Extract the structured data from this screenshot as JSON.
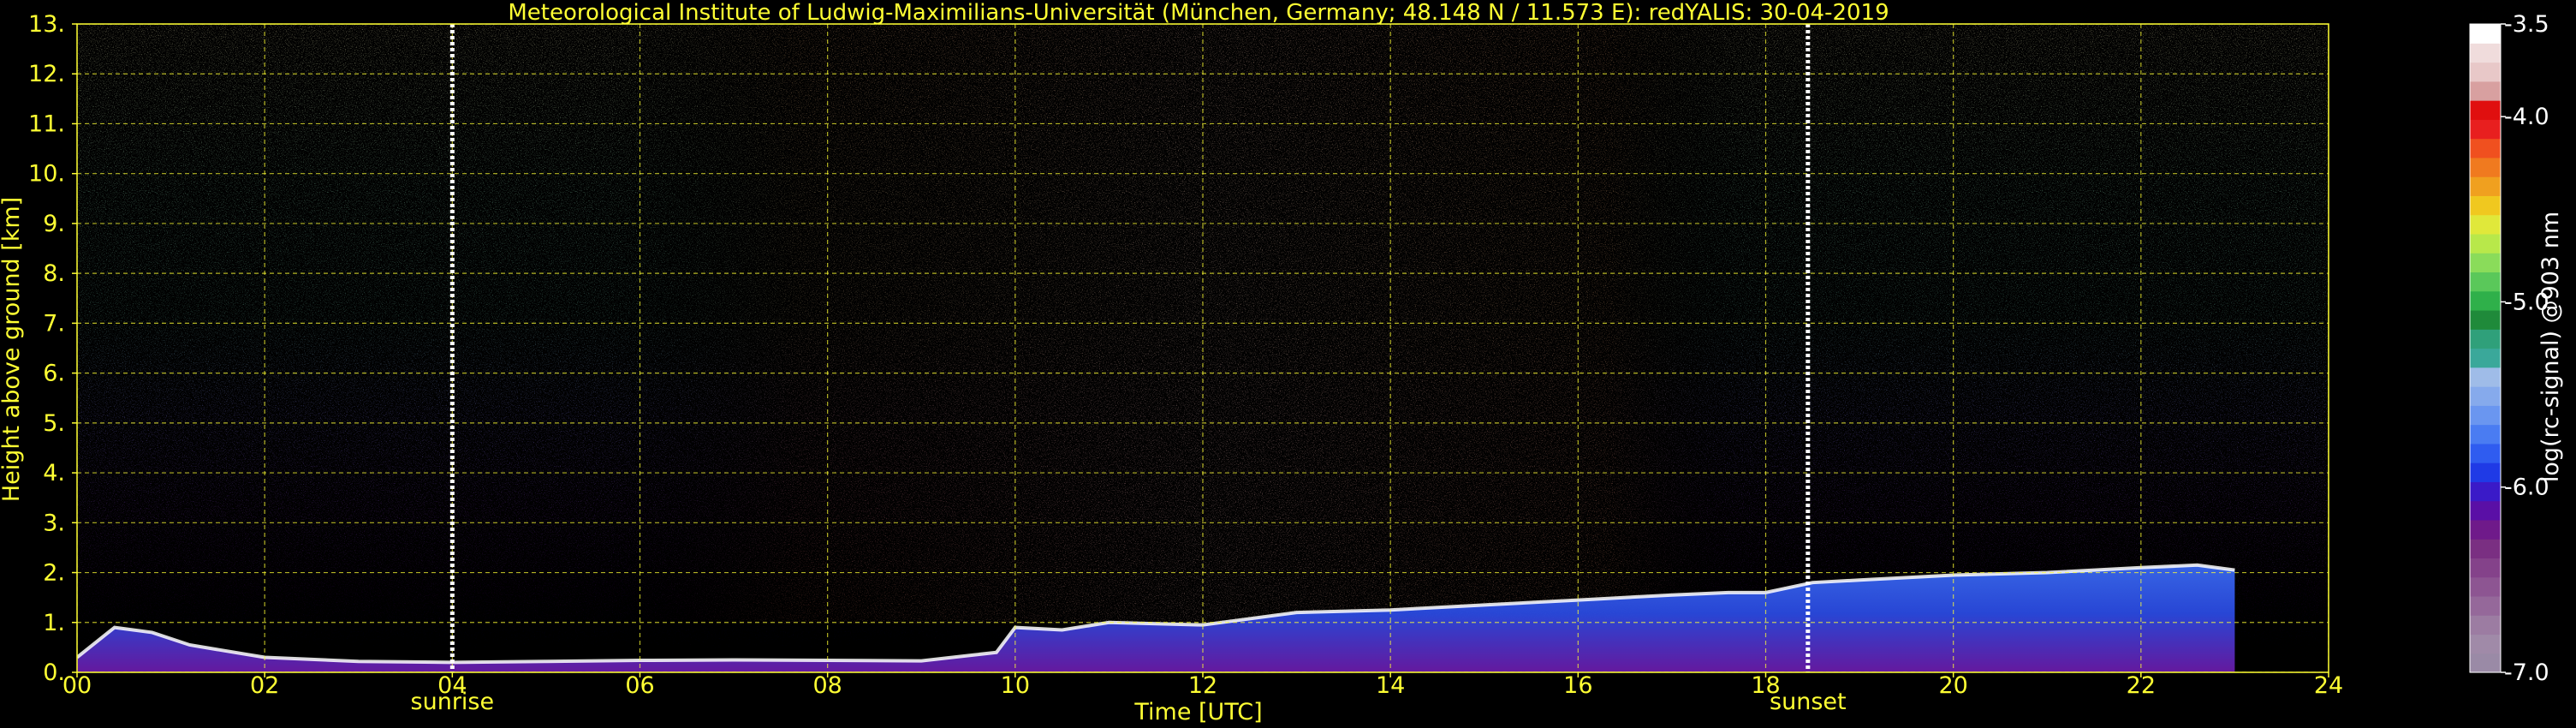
{
  "chart_data": {
    "type": "heatmap",
    "title": "Meteorological Institute of Ludwig-Maximilians-Universität (München, Germany; 48.148 N / 11.573 E):    redYALIS: 30-04-2019",
    "xlabel": "Time [UTC]",
    "ylabel": "Height above ground [km]",
    "colorbar_label": "log(rc-signal) @903 nm",
    "xlim": [
      0,
      24
    ],
    "ylim": [
      0,
      13
    ],
    "x_ticks": [
      0,
      2,
      4,
      6,
      8,
      10,
      12,
      14,
      16,
      18,
      20,
      22,
      24
    ],
    "x_tick_labels": [
      "00",
      "02",
      "04",
      "06",
      "08",
      "10",
      "12",
      "14",
      "16",
      "18",
      "20",
      "22",
      "24"
    ],
    "y_ticks": [
      0,
      1,
      2,
      3,
      4,
      5,
      6,
      7,
      8,
      9,
      10,
      11,
      12,
      13
    ],
    "y_tick_labels": [
      "0.",
      "1.",
      "2.",
      "3.",
      "4.",
      "5.",
      "6.",
      "7.",
      "8.",
      "9.",
      "10.",
      "11.",
      "12.",
      "13."
    ],
    "grid": true,
    "colorbar": {
      "range": [
        -7.0,
        -3.5
      ],
      "ticks": [
        -7.0,
        -6.0,
        -5.0,
        -4.0,
        -3.5
      ],
      "tick_labels": [
        "-7.0",
        "-6.0",
        "-5.0",
        "-4.0",
        "-3.5"
      ],
      "colors": [
        "#9a8aa6",
        "#a08aa8",
        "#9c7ca2",
        "#95689a",
        "#8d5592",
        "#84428a",
        "#7a2f82",
        "#6f1a8a",
        "#5a0fa6",
        "#3a1ac8",
        "#1f3ae6",
        "#2f5cf0",
        "#4a7cf2",
        "#6a96f0",
        "#86aaec",
        "#9fbce8",
        "#3aa89a",
        "#2fa07a",
        "#1f8a3a",
        "#2fb04a",
        "#5ac85a",
        "#8adc5a",
        "#b8e84a",
        "#e0e83a",
        "#f0c81f",
        "#f0a01f",
        "#f07a1f",
        "#f0501f",
        "#e81f1f",
        "#e00f0f",
        "#d8a0a0",
        "#e8c8c8",
        "#f0dcdc",
        "#ffffff"
      ]
    },
    "annotations": [
      {
        "x": 4.0,
        "label": "sunrise"
      },
      {
        "x": 18.45,
        "label": "sunset"
      }
    ],
    "boundary_layer_top_km": {
      "x": [
        0,
        0.4,
        0.8,
        1.2,
        2,
        3,
        4,
        5,
        6,
        7,
        8,
        9,
        9.8,
        10,
        10.5,
        11,
        12,
        13,
        14,
        15,
        16,
        17,
        17.6,
        18,
        18.5,
        19,
        20,
        21,
        22,
        22.6,
        23
      ],
      "values": [
        0.3,
        0.9,
        0.8,
        0.55,
        0.3,
        0.22,
        0.2,
        0.22,
        0.24,
        0.25,
        0.24,
        0.23,
        0.4,
        0.9,
        0.85,
        1.0,
        0.95,
        1.2,
        1.25,
        1.35,
        1.45,
        1.55,
        1.6,
        1.6,
        1.8,
        1.85,
        1.95,
        2.0,
        2.1,
        2.15,
        2.05
      ]
    }
  }
}
